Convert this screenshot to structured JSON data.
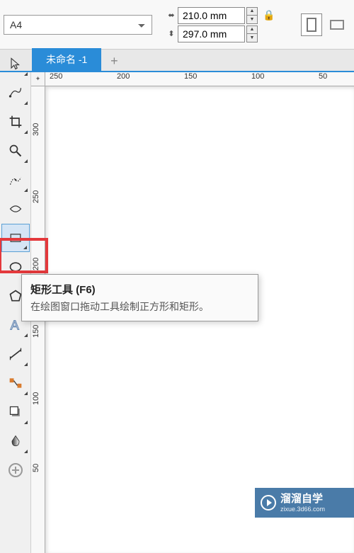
{
  "toolbar": {
    "page_size": "A4",
    "width": "210.0 mm",
    "height": "297.0 mm"
  },
  "tabs": {
    "active": "未命名 -1",
    "add": "+"
  },
  "ruler": {
    "h_labels": [
      "250",
      "200",
      "150",
      "100",
      "50"
    ],
    "v_labels": [
      "300",
      "250",
      "200",
      "150",
      "100",
      "50"
    ]
  },
  "tooltip": {
    "title": "矩形工具 (F6)",
    "desc": "在绘图窗口拖动工具绘制正方形和矩形。"
  },
  "watermark": {
    "name": "溜溜自学",
    "url": "zixue.3d66.com"
  },
  "corner": "✦"
}
